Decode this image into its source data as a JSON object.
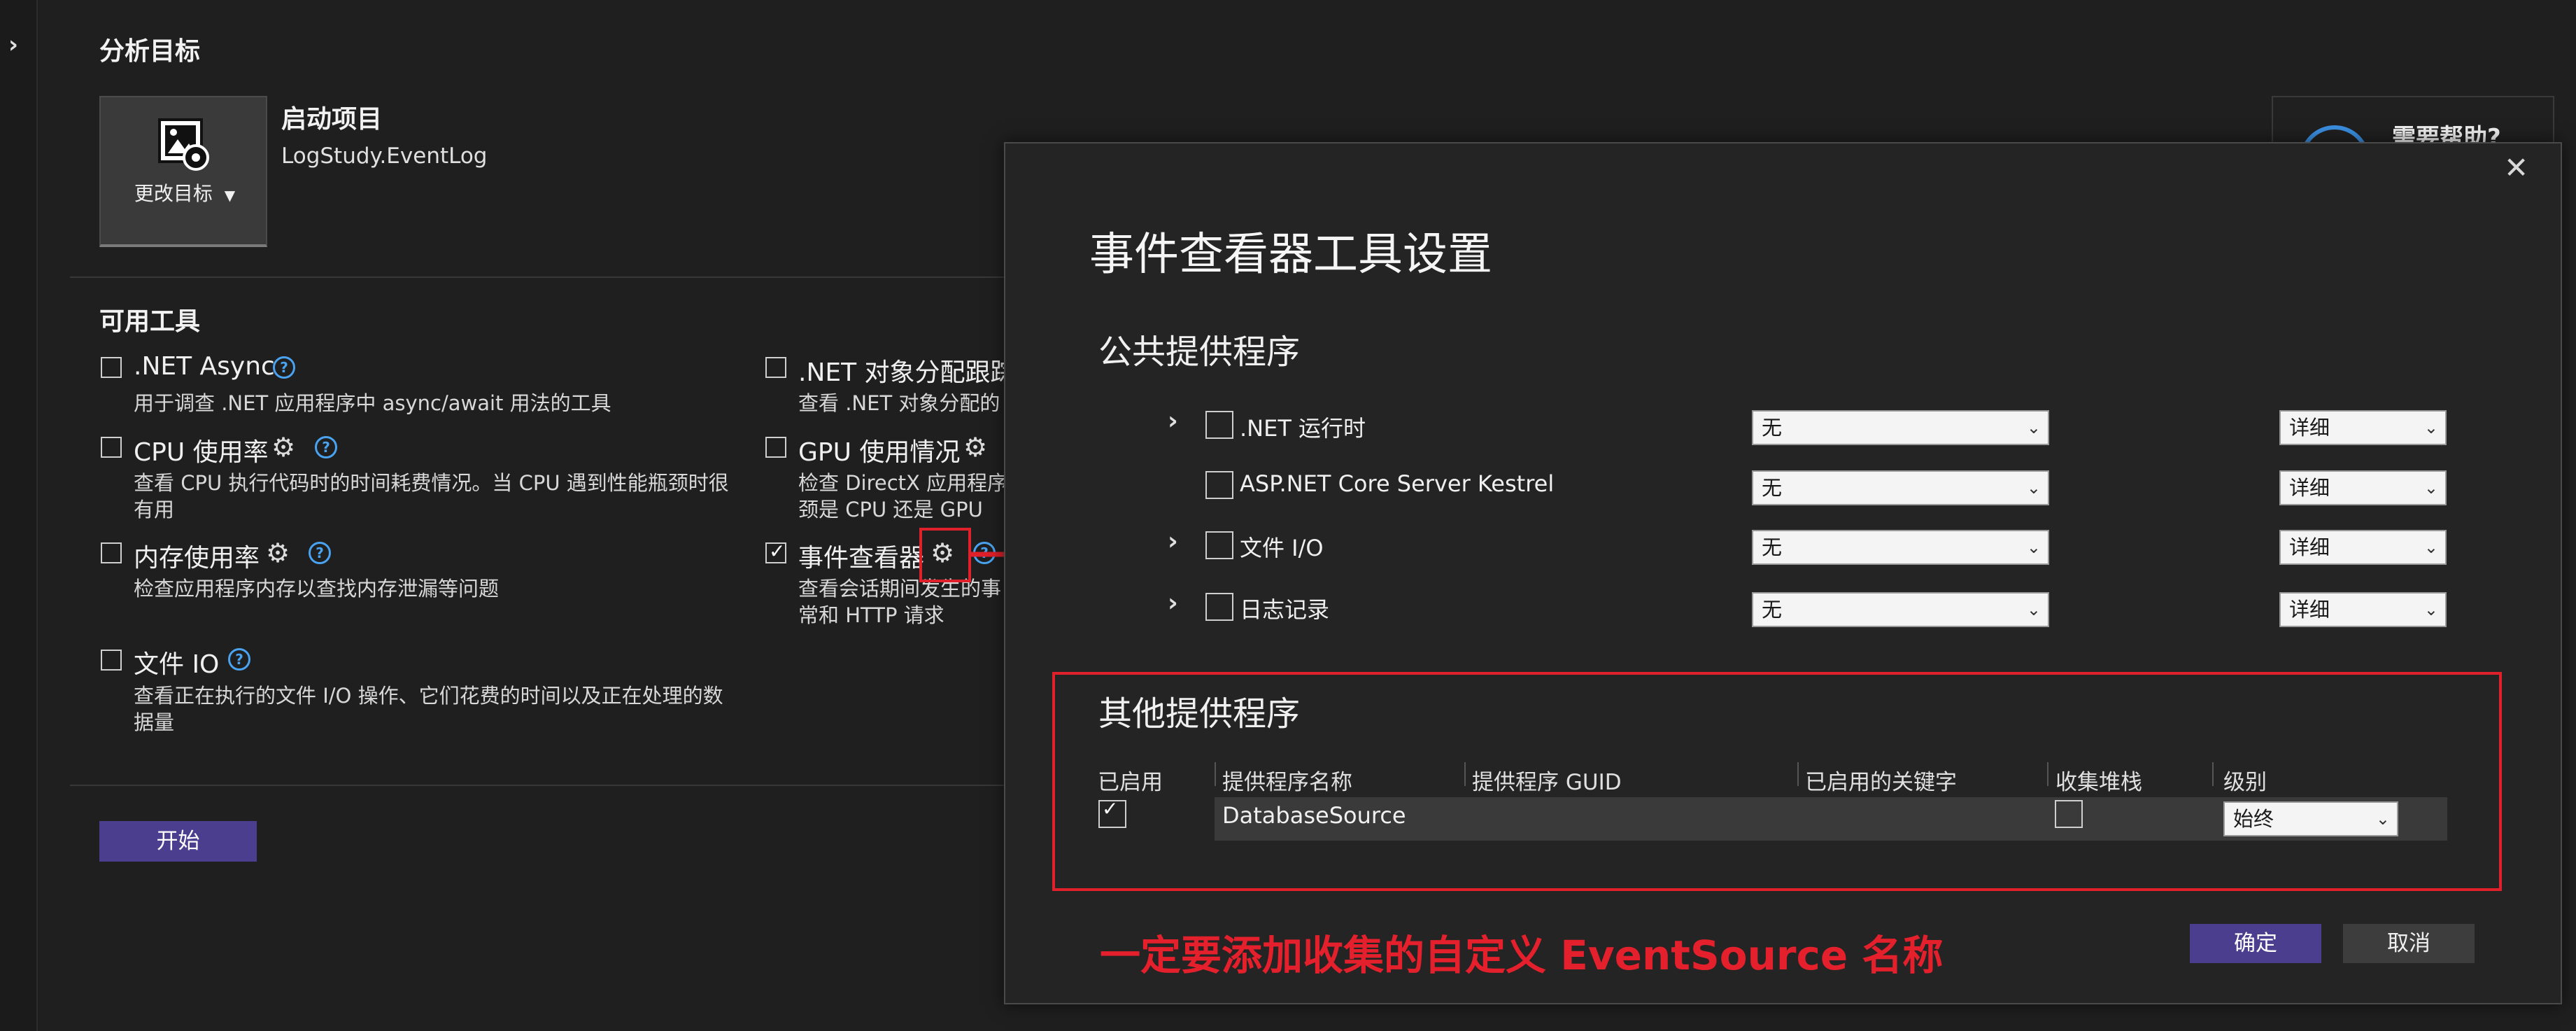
{
  "sidebar": {
    "expand_icon": "chevron-right-icon"
  },
  "target": {
    "heading": "分析目标",
    "change_label": "更改目标",
    "startup_title": "启动项目",
    "project_name": "LogStudy.EventLog"
  },
  "tools": {
    "heading": "可用工具",
    "items": [
      {
        "title": ".NET Async",
        "desc": [
          "用于调查 .NET 应用程序中 async/await 用法的工具"
        ],
        "checked": false
      },
      {
        "title": "CPU 使用率",
        "desc": [
          "查看 CPU 执行代码时的时间耗费情况。当 CPU 遇到性能瓶颈时很",
          "有用"
        ],
        "checked": false
      },
      {
        "title": "内存使用率",
        "desc": [
          "检查应用程序内存以查找内存泄漏等问题"
        ],
        "checked": false
      },
      {
        "title": "文件 IO",
        "desc": [
          "查看正在执行的文件 I/O 操作、它们花费的时间以及正在处理的数",
          "据量"
        ],
        "checked": false
      },
      {
        "title": ".NET 对象分配跟踪",
        "desc": [
          "查看 .NET 对象分配的"
        ],
        "checked": false
      },
      {
        "title": "GPU 使用情况",
        "desc": [
          "检查 DirectX 应用程序",
          "颈是 CPU 还是 GPU"
        ],
        "checked": false
      },
      {
        "title": "事件查看器",
        "desc": [
          "查看会话期间发生的事",
          "常和 HTTP 请求"
        ],
        "checked": true
      }
    ],
    "start_button": "开始"
  },
  "help_card": {
    "text": "需要帮助?"
  },
  "dialog": {
    "title": "事件查看器工具设置",
    "public_providers_heading": "公共提供程序",
    "providers": [
      {
        "name": ".NET 运行时",
        "expandable": true,
        "checked": false,
        "keyword": "无",
        "level": "详细"
      },
      {
        "name": "ASP.NET Core Server Kestrel",
        "expandable": false,
        "checked": false,
        "keyword": "无",
        "level": "详细"
      },
      {
        "name": "文件 I/O",
        "expandable": true,
        "checked": false,
        "keyword": "无",
        "level": "详细"
      },
      {
        "name": "日志记录",
        "expandable": true,
        "checked": false,
        "keyword": "无",
        "level": "详细"
      }
    ],
    "other_providers_heading": "其他提供程序",
    "table_headers": [
      "已启用",
      "提供程序名称",
      "提供程序 GUID",
      "已启用的关键字",
      "收集堆栈",
      "级别"
    ],
    "table_row": {
      "enabled": true,
      "name": "DatabaseSource",
      "guid": "",
      "keywords": "",
      "collect_stack": false,
      "level": "始终"
    },
    "ok_button": "确定",
    "cancel_button": "取消"
  },
  "annotation": {
    "text": "一定要添加收集的自定义 EventSource 名称",
    "color": "#e3202c"
  },
  "colors": {
    "accent": "#4b3e8f",
    "help_blue": "#4aa3f0",
    "background": "#1f1f1f"
  }
}
